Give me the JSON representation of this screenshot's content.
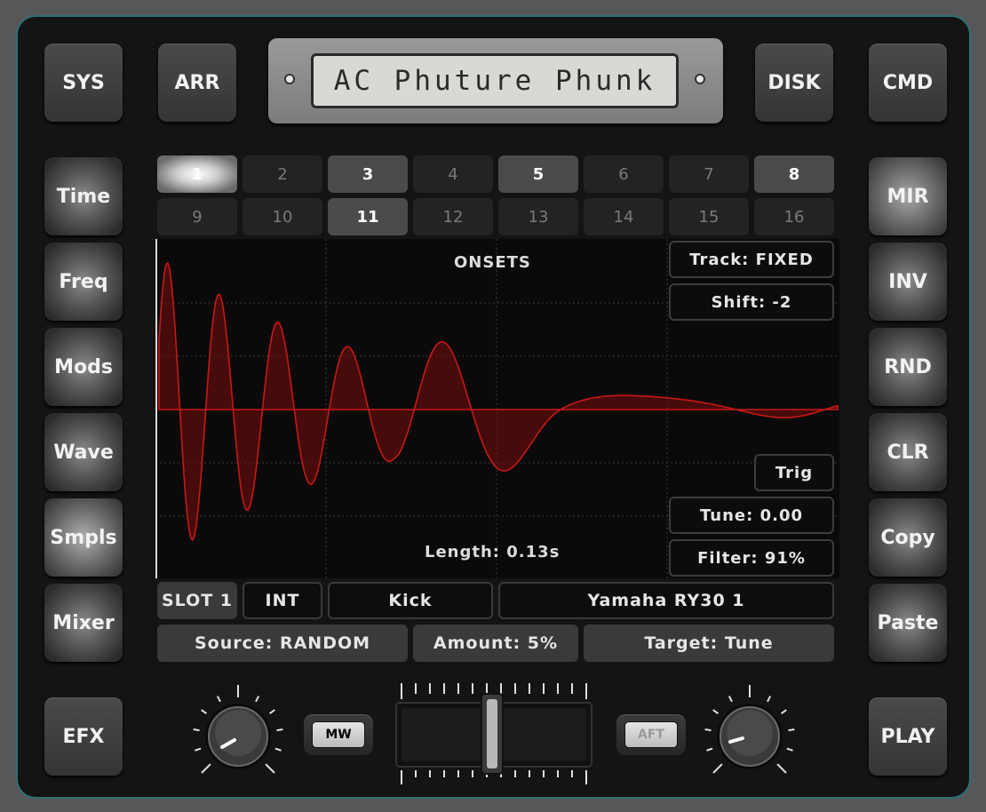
{
  "lcd": {
    "text": "AC Phuture Phunk"
  },
  "top_buttons": {
    "sys": "SYS",
    "arr": "ARR",
    "disk": "DISK",
    "cmd": "CMD"
  },
  "left_menu": [
    "Time",
    "Freq",
    "Mods",
    "Wave",
    "Smpls",
    "Mixer"
  ],
  "right_menu": [
    "MIR",
    "INV",
    "RND",
    "CLR",
    "Copy",
    "Paste"
  ],
  "bottom_buttons": {
    "efx": "EFX",
    "play": "PLAY"
  },
  "steps": [
    {
      "label": "1",
      "state": "cur"
    },
    {
      "label": "2",
      "state": "off"
    },
    {
      "label": "3",
      "state": "on"
    },
    {
      "label": "4",
      "state": "off"
    },
    {
      "label": "5",
      "state": "on"
    },
    {
      "label": "6",
      "state": "off"
    },
    {
      "label": "7",
      "state": "off"
    },
    {
      "label": "8",
      "state": "on"
    },
    {
      "label": "9",
      "state": "off"
    },
    {
      "label": "10",
      "state": "off"
    },
    {
      "label": "11",
      "state": "on"
    },
    {
      "label": "12",
      "state": "off"
    },
    {
      "label": "13",
      "state": "off"
    },
    {
      "label": "14",
      "state": "off"
    },
    {
      "label": "15",
      "state": "off"
    },
    {
      "label": "16",
      "state": "off"
    }
  ],
  "display": {
    "title": "ONSETS",
    "track": "Track: FIXED",
    "shift": "Shift: -2",
    "trig": "Trig",
    "tune": "Tune: 0.00",
    "filter": "Filter: 91%",
    "length": "Length: 0.13s",
    "waveform_color": "#c81818"
  },
  "slot_row": {
    "slot": "SLOT 1",
    "int": "INT",
    "instrument": "Kick",
    "kit": "Yamaha RY30 1"
  },
  "mod_row": {
    "source": "Source: RANDOM",
    "amount": "Amount: 5%",
    "target": "Target: Tune"
  },
  "controls": {
    "mw_label": "MW",
    "aft_label": "AFT"
  },
  "colors": {
    "accent_border": "#2f6f74",
    "waveform": "#c81818"
  }
}
